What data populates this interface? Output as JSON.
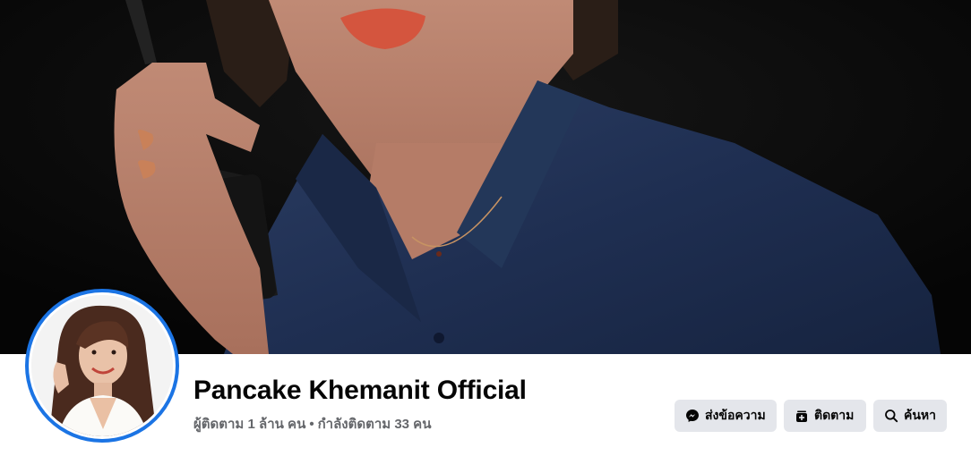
{
  "page": {
    "name": "Pancake Khemanit Official",
    "followers": "ผู้ติดตาม 1 ล้าน คน",
    "separator": "•",
    "following": "กำลังติดตาม 33 คน"
  },
  "actions": {
    "message_label": "ส่งข้อความ",
    "follow_label": "ติดตาม",
    "search_label": "ค้นหา"
  },
  "colors": {
    "avatar_ring": "#1b74e4",
    "button_bg": "#e4e6eb",
    "secondary_text": "#65676b"
  },
  "icons": {
    "message": "messenger-icon",
    "follow": "follow-icon",
    "search": "search-icon"
  }
}
